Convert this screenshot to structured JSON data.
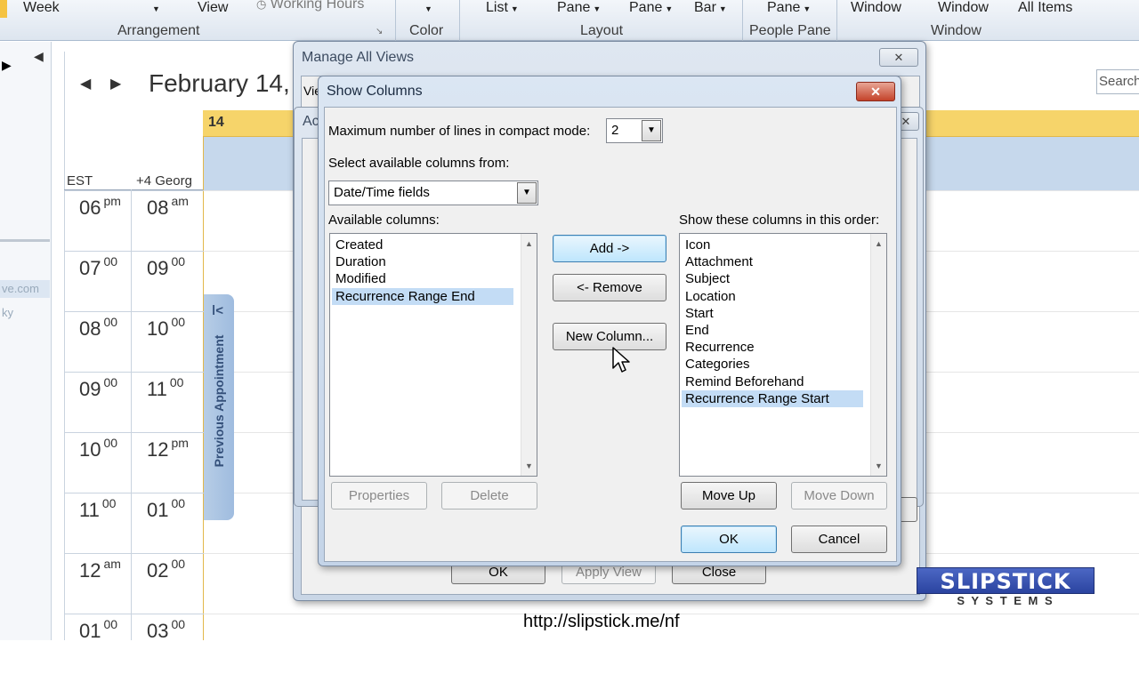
{
  "ribbon": {
    "items": [
      "Week",
      "View",
      "Working Hours",
      "List",
      "Pane",
      "Pane",
      "Bar",
      "Pane",
      "Window",
      "Window",
      "All Items"
    ],
    "groups": [
      "Arrangement",
      "Color",
      "Layout",
      "People Pane",
      "Window"
    ]
  },
  "calendar": {
    "date_header": "February 14,",
    "day_number": "14",
    "tz_left": "EST",
    "tz_right": "+4 Georg",
    "search_placeholder": "Search",
    "left_hours": [
      {
        "h": "06",
        "s": "pm"
      },
      {
        "h": "07",
        "s": "00"
      },
      {
        "h": "08",
        "s": "00"
      },
      {
        "h": "09",
        "s": "00"
      },
      {
        "h": "10",
        "s": "00"
      },
      {
        "h": "11",
        "s": "00"
      },
      {
        "h": "12",
        "s": "am"
      },
      {
        "h": "01",
        "s": "00"
      }
    ],
    "right_hours": [
      {
        "h": "08",
        "s": "am"
      },
      {
        "h": "09",
        "s": "00"
      },
      {
        "h": "10",
        "s": "00"
      },
      {
        "h": "11",
        "s": "00"
      },
      {
        "h": "12",
        "s": "pm"
      },
      {
        "h": "01",
        "s": "00"
      },
      {
        "h": "02",
        "s": "00"
      },
      {
        "h": "03",
        "s": "00"
      }
    ],
    "prev_appointment": "Previous Appointment",
    "leftnav_text1": "ve.com",
    "leftnav_text2": "ky"
  },
  "manage_views": {
    "title": "Manage All Views",
    "tab_fragment": "Vie",
    "sub_fragment": "Ac",
    "ok_label": "OK",
    "apply_label": "Apply View",
    "close_label": "Close"
  },
  "show_columns": {
    "title": "Show Columns",
    "max_lines_label": "Maximum number of lines in compact mode:",
    "max_lines_value": "2",
    "select_from_label": "Select available columns from:",
    "select_from_value": "Date/Time fields",
    "available_label": "Available columns:",
    "available": [
      "Created",
      "Duration",
      "Modified",
      "Recurrence Range End"
    ],
    "available_selected": 3,
    "show_label": "Show these columns in this order:",
    "shown": [
      "Icon",
      "Attachment",
      "Subject",
      "Location",
      "Start",
      "End",
      "Recurrence",
      "Categories",
      "Remind Beforehand",
      "Recurrence Range Start"
    ],
    "shown_selected": 9,
    "add_label": "Add ->",
    "remove_label": "<- Remove",
    "new_column_label": "New Column...",
    "properties_label": "Properties",
    "delete_label": "Delete",
    "move_up_label": "Move Up",
    "move_down_label": "Move Down",
    "ok_label": "OK",
    "cancel_label": "Cancel"
  },
  "watermark": {
    "logo_top": "SLIPSTICK",
    "logo_bottom": "S Y S T E M S",
    "url": "http://slipstick.me/nf"
  }
}
